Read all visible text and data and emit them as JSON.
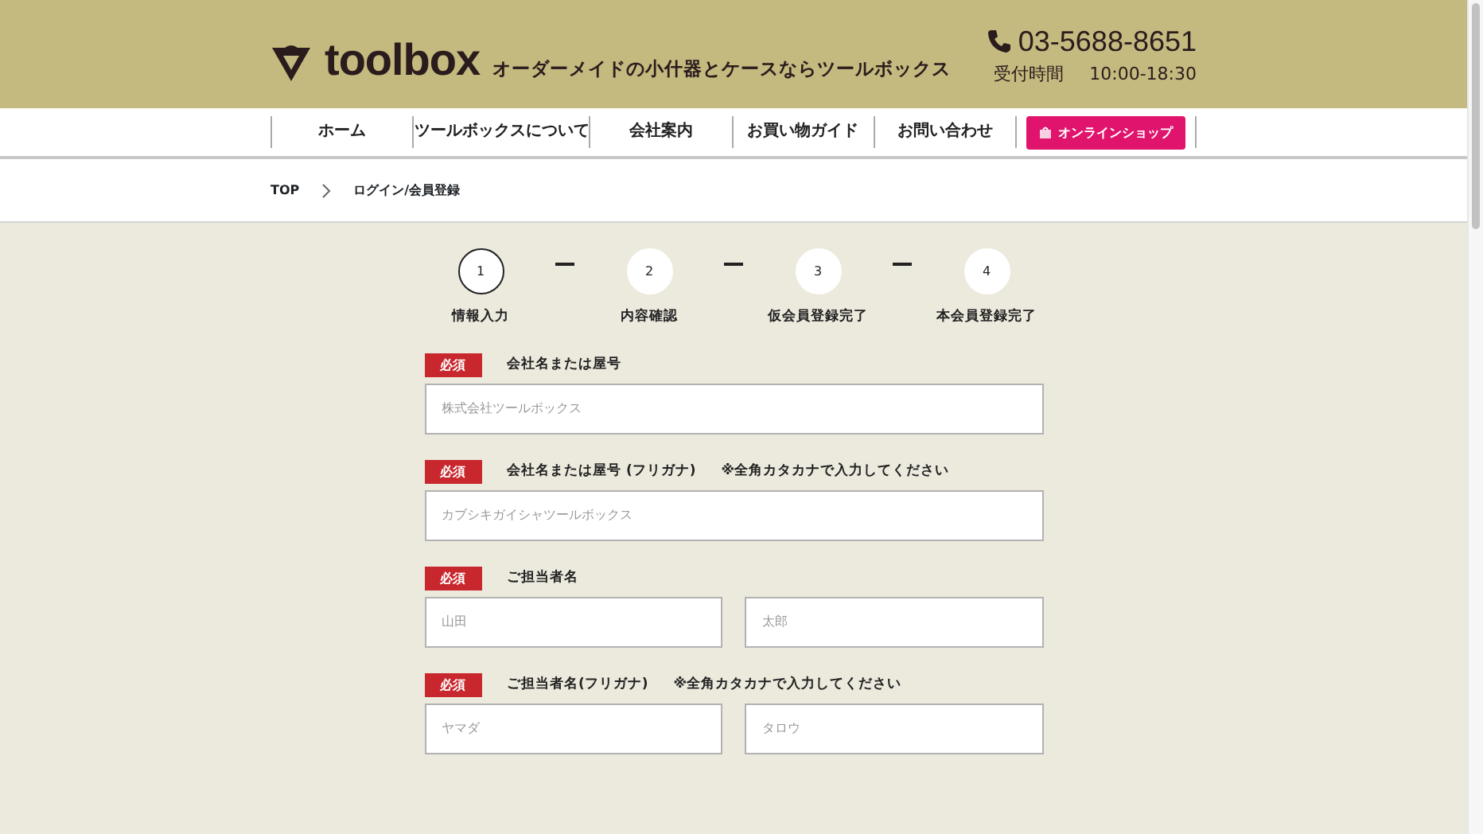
{
  "header": {
    "logo": "toolbox",
    "tagline": "オーダーメイドの小什器とケースならツールボックス",
    "phone": "03-5688-8651",
    "hours_label": "受付時間",
    "hours": "10:00-18:30"
  },
  "nav": [
    {
      "label": "ホーム",
      "kind": "link"
    },
    {
      "label": "ツールボックスについて",
      "kind": "link"
    },
    {
      "label": "会社案内",
      "kind": "link"
    },
    {
      "label": "お買い物ガイド",
      "kind": "link"
    },
    {
      "label": "お問い合わせ",
      "kind": "link"
    },
    {
      "label": "オンラインショップ",
      "kind": "shop"
    }
  ],
  "breadcrumb": [
    {
      "label": "TOP"
    },
    {
      "label": "ログイン/会員登録"
    }
  ],
  "steps": [
    {
      "number": "1",
      "label": "情報入力",
      "selected": true
    },
    {
      "number": "2",
      "label": "内容確認",
      "selected": false
    },
    {
      "number": "3",
      "label": "仮会員登録完了",
      "selected": false
    },
    {
      "number": "4",
      "label": "本会員登録完了",
      "selected": false
    }
  ],
  "fields": [
    {
      "badge": "必須",
      "label": "会社名または屋号",
      "inputs": [
        {
          "placeholder": "株式会社ツールボックス"
        }
      ]
    },
    {
      "badge": "必須",
      "label": "会社名または屋号 (フリガナ)",
      "note": "※全角カタカナで入力してください",
      "inputs": [
        {
          "placeholder": "カブシキガイシャツールボックス"
        }
      ]
    },
    {
      "badge": "必須",
      "label": "ご担当者名",
      "inputs": [
        {
          "placeholder": "山田"
        },
        {
          "placeholder": "太郎"
        }
      ]
    },
    {
      "badge": "必須",
      "label": "ご担当者名(フリガナ)",
      "note": "※全角カタカナで入力してください",
      "inputs": [
        {
          "placeholder": "ヤマダ"
        },
        {
          "placeholder": "タロウ"
        }
      ]
    }
  ]
}
